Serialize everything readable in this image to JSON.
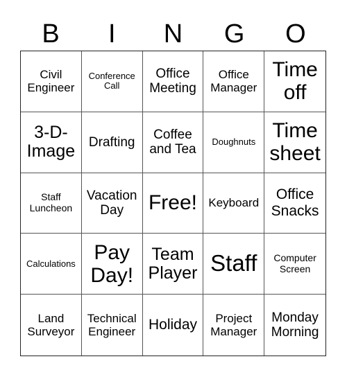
{
  "header": {
    "letters": [
      "B",
      "I",
      "N",
      "G",
      "O"
    ]
  },
  "cells": [
    "Civil Engineer",
    "Conference Call",
    "Office Meeting",
    "Office Manager",
    "Time off",
    "3-D-Image",
    "Drafting",
    "Coffee and Tea",
    "Doughnuts",
    "Time sheet",
    "Staff Luncheon",
    "Vacation Day",
    "Free!",
    "Keyboard",
    "Office Snacks",
    "Calculations",
    "Pay Day!",
    "Team Player",
    "Staff",
    "Computer Screen",
    "Land Surveyor",
    "Technical Engineer",
    "Holiday",
    "Project Manager",
    "Monday Morning"
  ]
}
